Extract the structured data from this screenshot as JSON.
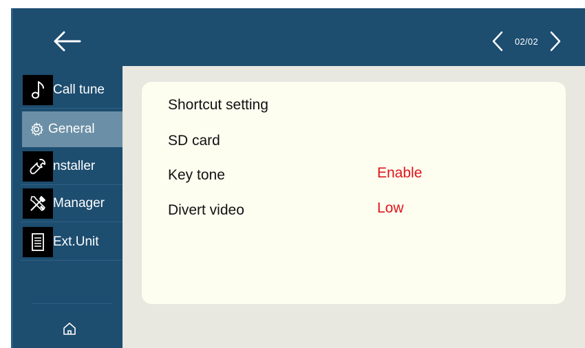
{
  "header": {
    "back_icon": "arrow-left-icon",
    "pager": {
      "prev_icon": "chevron-left-icon",
      "indicator": "02/02",
      "next_icon": "chevron-right-icon"
    }
  },
  "sidebar": {
    "items": [
      {
        "label": "Call tune",
        "icon": "music-note-icon",
        "active": false
      },
      {
        "label": "General",
        "icon": "gear-icon",
        "active": true
      },
      {
        "label": "nstaller",
        "icon": "wrench-icon",
        "active": false
      },
      {
        "label": "Manager",
        "icon": "tools-icon",
        "active": false
      },
      {
        "label": "Ext.Unit",
        "icon": "document-icon",
        "active": false
      }
    ],
    "home_icon": "home-icon"
  },
  "settings": {
    "rows": [
      {
        "label": "Shortcut setting",
        "value": ""
      },
      {
        "label": "SD card",
        "value": ""
      },
      {
        "label": "Key tone",
        "value": "Enable"
      },
      {
        "label": "Divert video",
        "value": "Low"
      }
    ]
  },
  "colors": {
    "frame": "#1d4d6f",
    "active_item": "#6b8fa6",
    "content_bg": "#e8e7e0",
    "card_bg": "#fdfdf0",
    "value_red": "#e0141b"
  }
}
